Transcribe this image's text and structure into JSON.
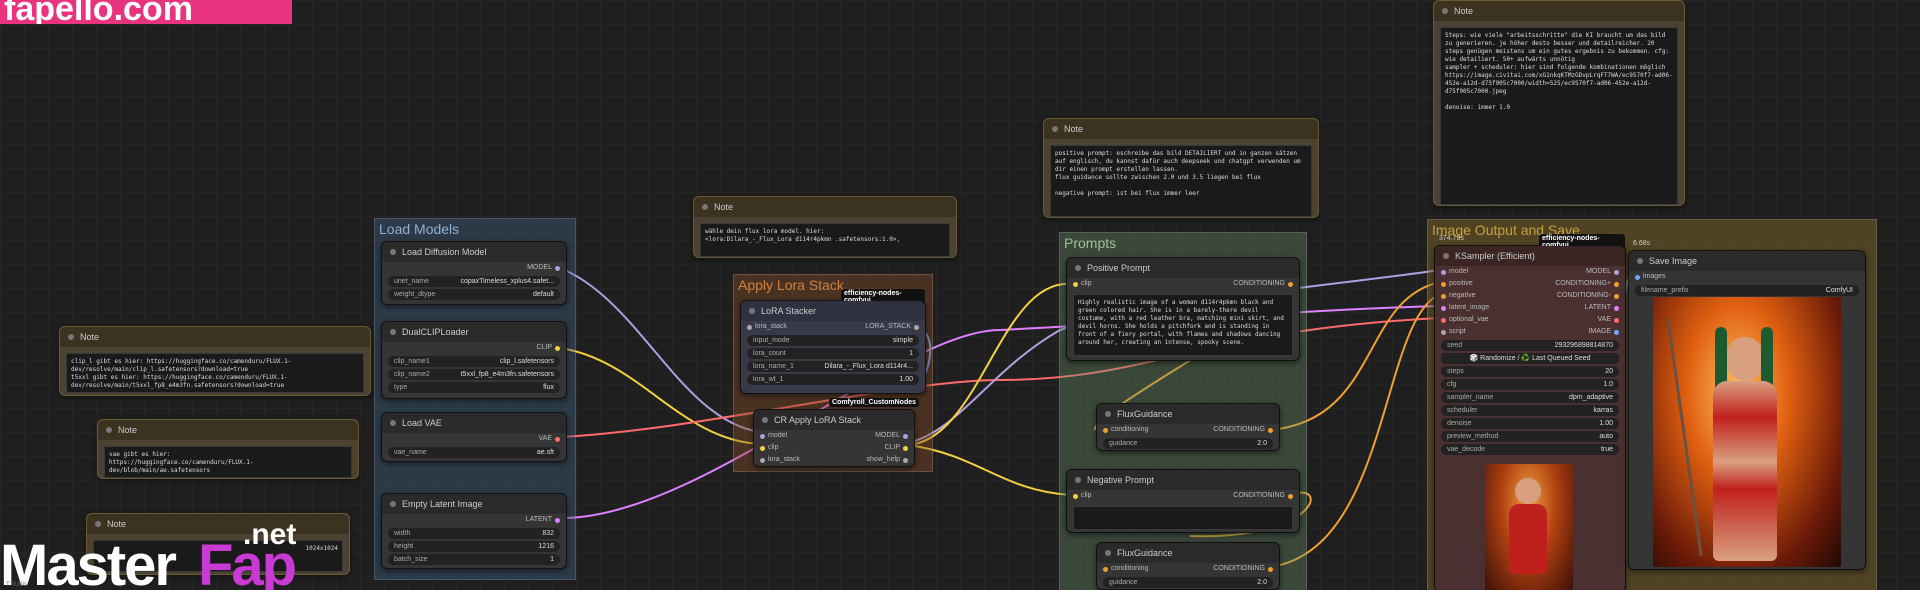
{
  "watermarks": {
    "top": "fapello.com",
    "bottom_a": "Master",
    "bottom_b": "Fap",
    "bottom_net": ".net"
  },
  "status": "T: 0.00s",
  "groups": {
    "load_models": "Load Models",
    "apply_lora": "Apply Lora Stack",
    "prompts": "Prompts",
    "image_output": "Image Output and Save"
  },
  "notes": [
    {
      "title": "Note",
      "text": "clip_l gibt es hier: https://huggingface.co/camenduru/FLUX.1-dev/resolve/main/clip_l.safetensors?download=true\nt5xxl gibt es hier: https://huggingface.co/camenduru/FLUX.1-dev/resolve/main/t5xxl_fp8_e4m3fn.safetensors?download=true"
    },
    {
      "title": "Note",
      "text": "vae gibt es hier:\nhttps://huggingface.co/camenduru/FLUX.1-dev/blob/main/ae.safetensors"
    },
    {
      "title": "Note",
      "text": "1024x1024"
    },
    {
      "title": "Note",
      "text": "wähle dein flux lora model. hier:\n<lora:Dilara_-_Flux_Lora d114r4pkmn .safetensors:1.0>,"
    },
    {
      "title": "Note",
      "text": "positive prompt: eschreibe das bild DETAILIERT und in ganzen sätzen auf englisch, du kannst dafür auch deepseek und chatgpt verwenden um dir einen prompt erstellen lassen.\nflux guidance sollte zwischen 2.0 und 3.5 liegen bei flux\n\nnegative prompt: ist bei flux immer leer"
    },
    {
      "title": "Note",
      "text": "Steps: wie viele \"arbeitsschritte\" die KI braucht um das bild zu generieren. je höher desto besser und detailreicher. 20 steps genügen meistens um ein gutes ergebnis zu bekommen. cfg: wie detailiert. 50+ aufwärts unnötig\nsampler + scheduler: hier sind folgende kombinationen möglich\nhttps://image.civitai.com/xG1nkqKTMzGDvpLrqFT7WA/ec9570f7-ad06-452e-a12d-d75f905c7000/width=525/ec9570f7-ad06-452e-a12d-d75f905c7000.jpeg\n\ndenoise: immer 1.0"
    }
  ],
  "load_diffusion": {
    "title": "Load Diffusion Model",
    "out": "MODEL",
    "w": [
      [
        "unet_name",
        "copaxTimeless_xplus4.safet..."
      ],
      [
        "weight_dtype",
        "default"
      ]
    ]
  },
  "dualclip": {
    "title": "DualCLIPLoader",
    "out": "CLIP",
    "w": [
      [
        "clip_name1",
        "clip_l.safetensors"
      ],
      [
        "clip_name2",
        "t5xxl_fp8_e4m3fn.safetensors"
      ],
      [
        "type",
        "flux"
      ]
    ]
  },
  "load_vae": {
    "title": "Load VAE",
    "out": "VAE",
    "w": [
      [
        "vae_name",
        "ae.sft"
      ]
    ]
  },
  "empty_latent": {
    "title": "Empty Latent Image",
    "out": "LATENT",
    "w": [
      [
        "width",
        "832"
      ],
      [
        "height",
        "1216"
      ],
      [
        "batch_size",
        "1"
      ]
    ]
  },
  "lora_stacker": {
    "title": "LoRA Stacker",
    "badge": "efficiency-nodes-comfyui",
    "in": "lora_stack",
    "out": "LORA_STACK",
    "w": [
      [
        "input_mode",
        "simple"
      ],
      [
        "lora_count",
        "1"
      ],
      [
        "lora_name_1",
        "Dilara_-_Flux_Lora d114r4..."
      ],
      [
        "lora_wt_1",
        "1.00"
      ]
    ]
  },
  "cr_apply": {
    "title": "CR Apply LoRA Stack",
    "badge": "Comfyroll_CustomNodes",
    "ins": [
      "model",
      "clip",
      "lora_stack"
    ],
    "outs": [
      "MODEL",
      "CLIP",
      "show_help"
    ]
  },
  "positive": {
    "title": "Positive Prompt",
    "in": "clip",
    "out": "CONDITIONING",
    "text": "Highly realistic image of a woman d114r4pkmn black and green colored hair. She is in a barely-there devil costume, with a red leather bra, matching mini skirt, and devil horns. She holds a pitchfork and is standing in front of a fiery portal, with flames and shadows dancing around her, creating an intense, spooky scene."
  },
  "flux1": {
    "title": "FluxGuidance",
    "in": "conditioning",
    "out": "CONDITIONING",
    "w": [
      [
        "guidance",
        "2.0"
      ]
    ]
  },
  "negative": {
    "title": "Negative Prompt",
    "in": "clip",
    "out": "CONDITIONING"
  },
  "flux2": {
    "title": "FluxGuidance",
    "in": "conditioning",
    "out": "CONDITIONING",
    "w": [
      [
        "guidance",
        "2.0"
      ]
    ]
  },
  "ksampler": {
    "title": "KSampler (Efficient)",
    "badge": "efficiency-nodes-comfyui",
    "time": "374.79s",
    "ins": [
      "model",
      "positive",
      "negative",
      "latent_image",
      "optional_vae",
      "script"
    ],
    "outs": [
      "MODEL",
      "CONDITIONING+",
      "CONDITIONING-",
      "LATENT",
      "VAE",
      "IMAGE"
    ],
    "seed": [
      "seed",
      "293296898814870"
    ],
    "seedbtn": "🎲 Randomize / ♻️ Last Queued Seed",
    "w": [
      [
        "steps",
        "20"
      ],
      [
        "cfg",
        "1.0"
      ],
      [
        "sampler_name",
        "dpm_adaptive"
      ],
      [
        "scheduler",
        "karras"
      ],
      [
        "denoise",
        "1.00"
      ],
      [
        "preview_method",
        "auto"
      ],
      [
        "vae_decode",
        "true"
      ]
    ]
  },
  "save_image": {
    "title": "Save Image",
    "time": "6.68s",
    "in": "images",
    "w": [
      [
        "filename_prefix",
        "ComfyUI"
      ]
    ]
  }
}
